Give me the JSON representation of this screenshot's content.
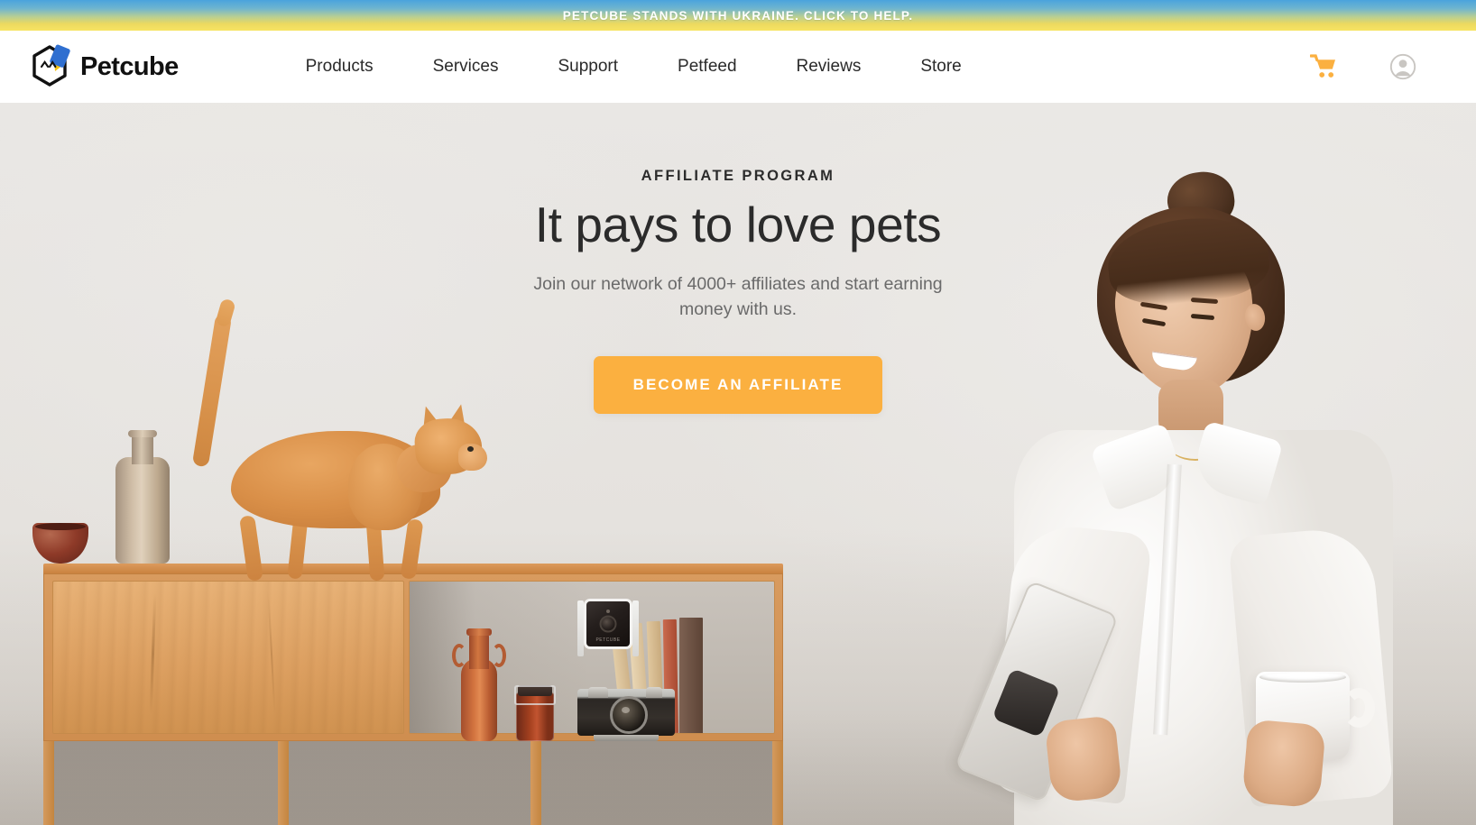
{
  "banner": {
    "text": "PETCUBE STANDS WITH UKRAINE. CLICK TO HELP.",
    "gradient_from": "#4aa3dd",
    "gradient_to": "#f7e463"
  },
  "header": {
    "logo_text": "Petcube",
    "logo_icon": "petcube-hexagon-cat-logo",
    "nav": [
      {
        "label": "Products"
      },
      {
        "label": "Services"
      },
      {
        "label": "Support"
      },
      {
        "label": "Petfeed"
      },
      {
        "label": "Reviews"
      },
      {
        "label": "Store"
      }
    ],
    "cart_icon": "shopping-cart-icon",
    "cart_color": "#fbb040",
    "account_icon": "user-account-icon",
    "account_color": "#c9c6c2"
  },
  "hero": {
    "eyebrow": "AFFILIATE PROGRAM",
    "title": "It pays to love pets",
    "subtitle": "Join our network of 4000+ affiliates and start earning money with us.",
    "cta_label": "BECOME AN AFFILIATE",
    "cta_color": "#fbb040",
    "background_color": "#e8e6e3",
    "scene": {
      "cat": "orange-abyssinian-cat-walking",
      "woman": "smiling-woman-with-phone-and-mug",
      "device": "petcube-camera",
      "device_brand": "PETCUBE",
      "furniture": "wooden-sideboard-shelf",
      "objects": [
        "ceramic-bowl",
        "tall-stone-vase",
        "terracotta-amphora-vase",
        "glass-spice-jar",
        "vintage-film-camera",
        "books"
      ]
    }
  }
}
